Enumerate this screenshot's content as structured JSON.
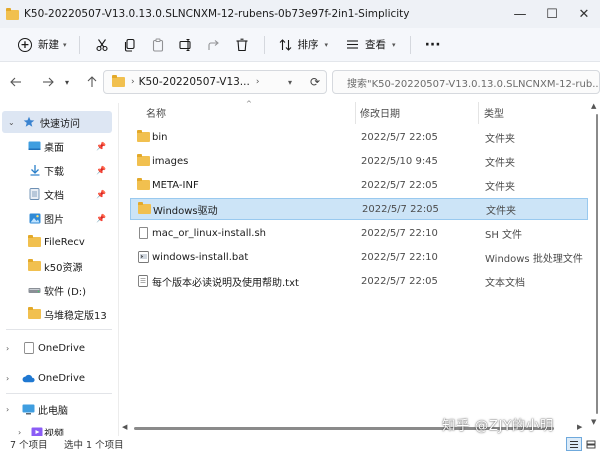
{
  "window": {
    "title": "K50-20220507-V13.0.13.0.SLNCNXM-12-rubens-0b73e97f-2in1-Simplicity",
    "controls": {
      "minimize": "—",
      "maximize": "☐",
      "close": "✕"
    }
  },
  "toolbar": {
    "new_label": "新建",
    "sort_label": "排序",
    "view_label": "查看",
    "more": "···",
    "icons": [
      "cut-icon",
      "copy-icon",
      "paste-icon",
      "rename-icon",
      "share-icon",
      "delete-icon"
    ]
  },
  "nav": {
    "address_path": "K50-20220507-V13...",
    "search_placeholder": "搜索\"K50-20220507-V13.0.13.0.SLNCNXM-12-rub..."
  },
  "sidebar": {
    "items": [
      {
        "label": "快速访问",
        "icon": "star-icon"
      },
      {
        "label": "桌面",
        "icon": "desktop-icon"
      },
      {
        "label": "下载",
        "icon": "download-icon"
      },
      {
        "label": "文档",
        "icon": "document-icon"
      },
      {
        "label": "图片",
        "icon": "picture-icon"
      },
      {
        "label": "FileRecv",
        "icon": "folder-icon"
      },
      {
        "label": "k50资源",
        "icon": "folder-icon"
      },
      {
        "label": "软件 (D:)",
        "icon": "drive-icon"
      },
      {
        "label": "乌堆稳定版13",
        "icon": "folder-icon"
      },
      {
        "label": "OneDrive",
        "icon": "onedrive-icon"
      },
      {
        "label": "OneDrive",
        "icon": "onedrive-cloud-icon"
      },
      {
        "label": "此电脑",
        "icon": "pc-icon"
      },
      {
        "label": "视频",
        "icon": "video-icon"
      }
    ]
  },
  "columns": {
    "name": "名称",
    "date": "修改日期",
    "type": "类型"
  },
  "files": [
    {
      "name": "bin",
      "date": "2022/5/7 22:05",
      "type": "文件夹",
      "icon": "folder-icon"
    },
    {
      "name": "images",
      "date": "2022/5/10 9:45",
      "type": "文件夹",
      "icon": "folder-icon"
    },
    {
      "name": "META-INF",
      "date": "2022/5/7 22:05",
      "type": "文件夹",
      "icon": "folder-icon"
    },
    {
      "name": "Windows驱动",
      "date": "2022/5/7 22:05",
      "type": "文件夹",
      "icon": "folder-icon"
    },
    {
      "name": "mac_or_linux-install.sh",
      "date": "2022/5/7 22:10",
      "type": "SH 文件",
      "icon": "file-icon"
    },
    {
      "name": "windows-install.bat",
      "date": "2022/5/7 22:10",
      "type": "Windows 批处理文件",
      "icon": "bat-file-icon"
    },
    {
      "name": "每个版本必读说明及使用帮助.txt",
      "date": "2022/5/7 22:05",
      "type": "文本文档",
      "icon": "text-file-icon"
    }
  ],
  "status": {
    "count": "7 个项目",
    "selected": "选中 1 个项目"
  },
  "watermark": "知乎 @ZJY的小明",
  "colors": {
    "folder": "#f1c04f",
    "selection": "#cce4f7",
    "sidebar_selected": "#dde6f3",
    "accent": "#0a64c8"
  }
}
